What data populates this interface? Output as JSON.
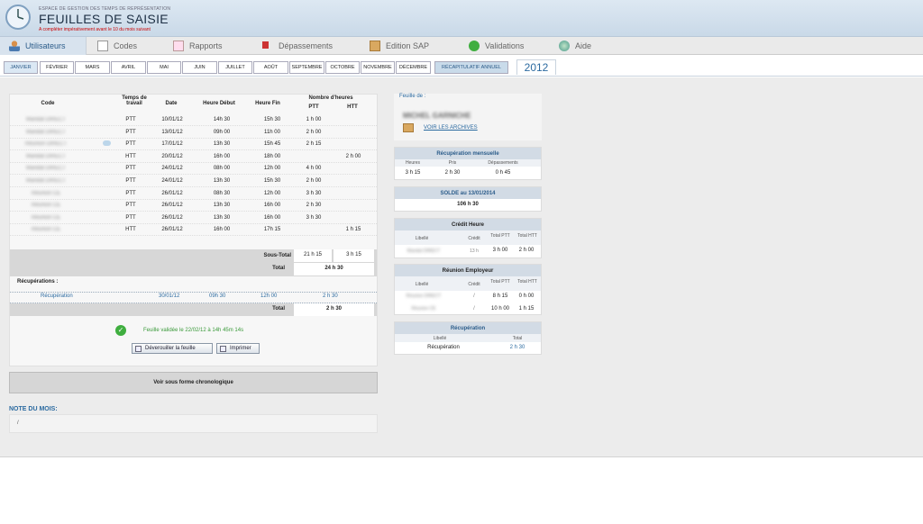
{
  "header": {
    "subtitle_small": "ESPACE DE GESTION DES TEMPS DE REPRÉSENTATION",
    "title": "FEUILLES DE SAISIE",
    "notice": "A compléter impérativement avant le 10 du mois suivant"
  },
  "menu": [
    {
      "label": "Utilisateurs",
      "icon": "user-icon",
      "active": true
    },
    {
      "label": "Codes",
      "icon": "edit-icon",
      "active": false
    },
    {
      "label": "Rapports",
      "icon": "report-icon",
      "active": false
    },
    {
      "label": "Dépassements",
      "icon": "flag-icon",
      "active": false
    },
    {
      "label": "Edition SAP",
      "icon": "box-icon",
      "active": false
    },
    {
      "label": "Validations",
      "icon": "check-icon",
      "active": false
    },
    {
      "label": "Aide",
      "icon": "help-icon",
      "active": false
    }
  ],
  "months": [
    "JANVIER",
    "FÉVRIER",
    "MARS",
    "AVRIL",
    "MAI",
    "JUIN",
    "JUILLET",
    "AOÛT",
    "SEPTEMBRE",
    "OCTOBRE",
    "NOVEMBRE",
    "DÉCEMBRE"
  ],
  "recap_tab": "RÉCAPITULATIF ANNUEL",
  "year": "2012",
  "table": {
    "headers": {
      "code": "Code",
      "temps": "Temps de travail",
      "date": "Date",
      "debut": "Heure Début",
      "fin": "Heure Fin",
      "nombre": "Nombre d'heures",
      "ptt": "PTT",
      "htt": "HTT"
    },
    "rows": [
      {
        "code": "Mandat DIRECT",
        "temps": "PTT",
        "date": "10/01/12",
        "debut": "14h 30",
        "fin": "15h 30",
        "ptt": "1 h 00",
        "htt": ""
      },
      {
        "code": "Mandat DIRECT",
        "temps": "PTT",
        "date": "13/01/12",
        "debut": "09h 00",
        "fin": "11h 00",
        "ptt": "2 h 00",
        "htt": ""
      },
      {
        "code": "Réunion DIRECT",
        "temps": "PTT",
        "date": "17/01/12",
        "debut": "13h 30",
        "fin": "15h 45",
        "ptt": "2 h 15",
        "htt": ""
      },
      {
        "code": "Mandat DIRECT",
        "temps": "HTT",
        "date": "20/01/12",
        "debut": "16h 00",
        "fin": "18h 00",
        "ptt": "",
        "htt": "2 h 00"
      },
      {
        "code": "Mandat DIRECT",
        "temps": "PTT",
        "date": "24/01/12",
        "debut": "08h 00",
        "fin": "12h 00",
        "ptt": "4 h 00",
        "htt": ""
      },
      {
        "code": "Mandat DIRECT",
        "temps": "PTT",
        "date": "24/01/12",
        "debut": "13h 30",
        "fin": "15h 30",
        "ptt": "2 h 00",
        "htt": ""
      },
      {
        "code": "Réunion CE",
        "temps": "PTT",
        "date": "26/01/12",
        "debut": "08h 30",
        "fin": "12h 00",
        "ptt": "3 h 30",
        "htt": ""
      },
      {
        "code": "Réunion CE",
        "temps": "PTT",
        "date": "26/01/12",
        "debut": "13h 30",
        "fin": "16h 00",
        "ptt": "2 h 30",
        "htt": ""
      },
      {
        "code": "Réunion CE",
        "temps": "PTT",
        "date": "26/01/12",
        "debut": "13h 30",
        "fin": "16h 00",
        "ptt": "3 h 30",
        "htt": ""
      },
      {
        "code": "Réunion CE",
        "temps": "HTT",
        "date": "26/01/12",
        "debut": "16h 00",
        "fin": "17h 15",
        "ptt": "",
        "htt": "1 h 15"
      }
    ],
    "subtotal_label": "Sous-Total",
    "subtotal_ptt": "21 h 15",
    "subtotal_htt": "3 h 15",
    "total_label": "Total",
    "total_value": "24 h 30",
    "recup_title": "Récupérations :",
    "recup_row": {
      "label": "Récupération",
      "date": "30/01/12",
      "debut": "09h 30",
      "fin": "12h 00",
      "value": "2 h 30"
    },
    "recup_total_label": "Total",
    "recup_total_value": "2 h 30"
  },
  "validation": {
    "text": "Feuille validée le 22/02/12 à 14h 45m 14s",
    "unlock_button": "Déverouiller la feuille",
    "print_button": "Imprimer"
  },
  "chrono_button": "Voir sous forme chronologique",
  "note": {
    "title": "NOTE DU MOIS:",
    "content": "/"
  },
  "right": {
    "feuille_label": "Feuille de :",
    "user_name": "MICHEL GARNICHE",
    "archives_link": "VOIR LES ARCHIVES",
    "recup_mensuelle": {
      "title": "Récupération mensuelle",
      "h1": "Heures",
      "h2": "Pris",
      "h3": "Dépassements",
      "v1": "3 h 15",
      "v2": "2 h 30",
      "v3": "0 h 45"
    },
    "solde": {
      "title": "SOLDE au 13/01/2014",
      "value": "106 h 30"
    },
    "credit": {
      "title": "Crédit Heure",
      "h_lib": "Libellé",
      "h_credit": "Crédit",
      "h_ptt": "Total PTT",
      "h_htt": "Total HTT",
      "row_lib": "Mandat DIRECT",
      "row_credit": "13 h",
      "row_ptt": "3 h 00",
      "row_htt": "2 h 00"
    },
    "reunion": {
      "title": "Réunion Employeur",
      "h_lib": "Libellé",
      "h_credit": "Crédit",
      "h_ptt": "Total PTT",
      "h_htt": "Total HTT",
      "rows": [
        {
          "lib": "Réunion DIRECT",
          "credit": "/",
          "ptt": "8 h 15",
          "htt": "0 h 00"
        },
        {
          "lib": "Réunion CE",
          "credit": "/",
          "ptt": "10 h 00",
          "htt": "1 h 15"
        }
      ]
    },
    "recuperation": {
      "title": "Récupération",
      "h_lib": "Libellé",
      "h_total": "Total",
      "row_lib": "Récupération",
      "row_total": "2 h 30"
    }
  },
  "colors": {
    "accent": "#2b6aa0",
    "valid": "#3a9a3a",
    "notice": "#cc0000",
    "band": "#d7d7d7"
  }
}
